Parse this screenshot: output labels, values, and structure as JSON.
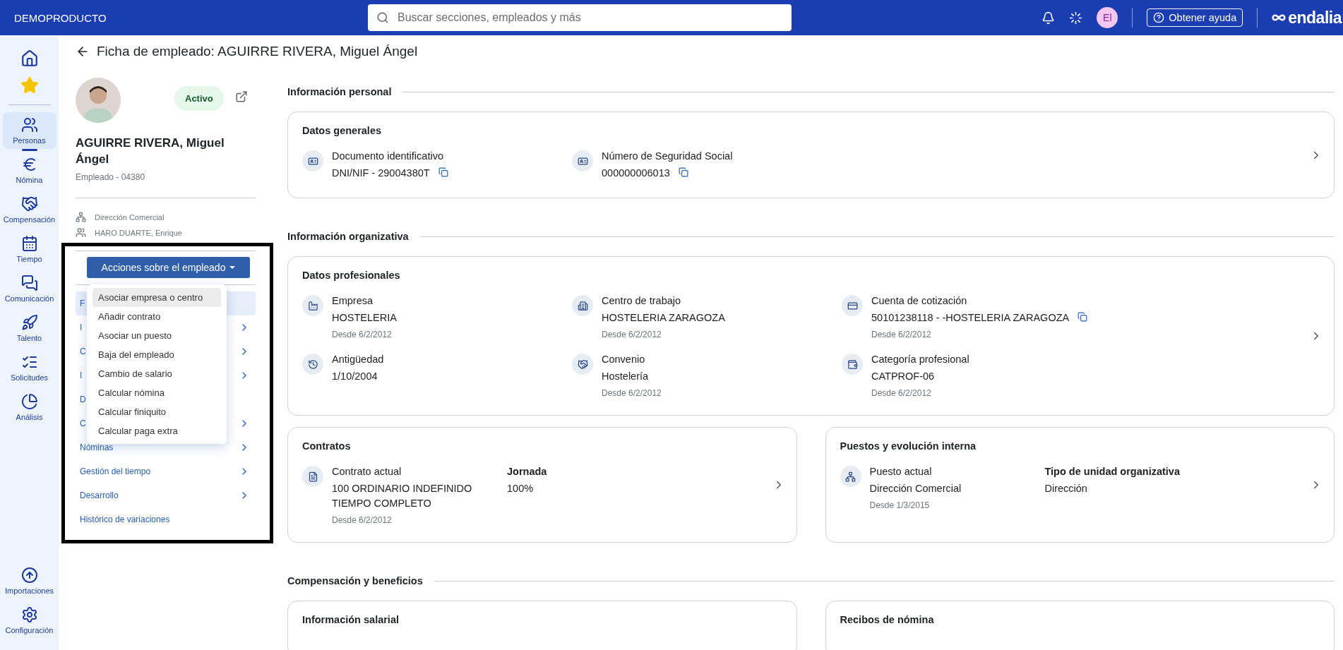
{
  "topbar": {
    "company": "DEMOPRODUCTO",
    "search": {
      "placeholder": "Buscar secciones, empleados y más"
    },
    "user_initials": "El",
    "help": "Obtener ayuda",
    "logo": "endalia"
  },
  "sidebar": {
    "top": [
      {
        "selected": false
      },
      {
        "selected": false
      }
    ],
    "items": [
      {
        "label": "Personas",
        "selected": true
      },
      {
        "label": "Nómina",
        "selected": false
      },
      {
        "label": "Compensación",
        "selected": false
      },
      {
        "label": "Tiempo",
        "selected": false
      },
      {
        "label": "Comunicación",
        "selected": false
      },
      {
        "label": "Talento",
        "selected": false
      },
      {
        "label": "Solicitudes",
        "selected": false
      },
      {
        "label": "Análisis",
        "selected": false
      }
    ],
    "bottom": [
      {
        "label": "Importaciones",
        "selected": false
      },
      {
        "label": "Configuración",
        "selected": false
      }
    ]
  },
  "page_title": "Ficha de empleado: AGUIRRE RIVERA, Miguel Ángel",
  "employee": {
    "status": "Activo",
    "name": "AGUIRRE RIVERA, Miguel Ángel",
    "code": "Empleado - 04380",
    "department": "Dirección Comercial",
    "manager": "HARO DUARTE, Enrique"
  },
  "actions": {
    "label": "Acciones sobre el empleado",
    "menu": [
      {
        "label": "Asociar empresa o centro",
        "selected": true
      },
      {
        "label": "Añadir contrato",
        "selected": false
      },
      {
        "label": "Asociar un puesto",
        "selected": false
      },
      {
        "label": "Baja del empleado",
        "selected": false
      },
      {
        "label": "Cambio de salario",
        "selected": false
      },
      {
        "label": "Calcular nómina",
        "selected": false
      },
      {
        "label": "Calcular finiquito",
        "selected": false
      },
      {
        "label": "Calcular paga extra",
        "selected": false
      }
    ]
  },
  "nav": [
    {
      "label": "F",
      "selected": true,
      "chevron": false
    },
    {
      "label": "I",
      "selected": false,
      "chevron": true
    },
    {
      "label": "C",
      "selected": false,
      "chevron": true
    },
    {
      "label": "I",
      "selected": false,
      "chevron": true
    },
    {
      "label": "D",
      "selected": false,
      "chevron": false
    },
    {
      "label": "C",
      "selected": false,
      "chevron": true
    },
    {
      "label": "Nóminas",
      "selected": false,
      "chevron": true
    },
    {
      "label": "Gestión del tiempo",
      "selected": false,
      "chevron": true
    },
    {
      "label": "Desarrollo",
      "selected": false,
      "chevron": true
    },
    {
      "label": "Histórico de variaciones",
      "selected": false,
      "chevron": false
    }
  ],
  "sections": [
    {
      "title": "Información personal",
      "rows": [
        [
          {
            "title": "Datos generales",
            "items": [
              {
                "kind": "field",
                "label": "Documento identificativo",
                "value": "DNI/NIF - 29004380T",
                "copyable": true
              },
              {
                "kind": "field",
                "label": "Número de Seguridad Social",
                "value": "000000006013",
                "copyable": true
              }
            ]
          }
        ]
      ]
    },
    {
      "title": "Información organizativa",
      "rows": [
        [
          {
            "title": "Datos profesionales",
            "items": [
              {
                "kind": "field",
                "label": "Empresa",
                "value": "HOSTELERIA",
                "since": "Desde 6/2/2012",
                "copyable": false
              },
              {
                "kind": "field",
                "label": "Centro de trabajo",
                "value": "HOSTELERIA ZARAGOZA",
                "since": "Desde 6/2/2012",
                "copyable": false
              },
              {
                "kind": "field",
                "label": "Cuenta de cotización",
                "value": "50101238118 - -HOSTELERIA ZARAGOZA",
                "since": "Desde 6/2/2012",
                "copyable": true
              },
              {
                "kind": "field",
                "label": "Antigüedad",
                "value": "1/10/2004",
                "copyable": false
              },
              {
                "kind": "field",
                "label": "Convenio",
                "value": "Hostelería",
                "since": "Desde 6/2/2012",
                "copyable": false
              },
              {
                "kind": "field",
                "label": "Categoría profesional",
                "value": "CATPROF-06",
                "since": "Desde 6/2/2012",
                "copyable": false
              }
            ]
          }
        ],
        [
          {
            "title": "Contratos",
            "items": [
              {
                "kind": "field",
                "label": "Contrato actual",
                "value": "100 ORDINARIO INDEFINIDO TIEMPO COMPLETO",
                "since": "Desde 6/2/2012",
                "copyable": false
              },
              {
                "kind": "plain",
                "label": "Jornada",
                "value": "100%"
              }
            ]
          },
          {
            "title": "Puestos y evolución interna",
            "items": [
              {
                "kind": "field",
                "label": "Puesto actual",
                "value": "Dirección Comercial",
                "since": "Desde 1/3/2015",
                "copyable": false
              },
              {
                "kind": "plain",
                "label": "Tipo de unidad organizativa",
                "value": "Dirección"
              }
            ]
          }
        ]
      ]
    },
    {
      "title": "Compensación y beneficios",
      "rows": [
        [
          {
            "title": "Información salarial"
          },
          {
            "title": "Recibos de nómina"
          }
        ]
      ]
    }
  ]
}
